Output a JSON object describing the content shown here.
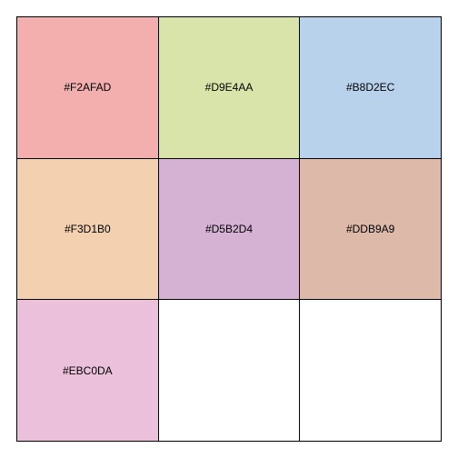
{
  "swatches": [
    {
      "label": "#F2AFAD",
      "color": "#F2AFAD"
    },
    {
      "label": "#D9E4AA",
      "color": "#D9E4AA"
    },
    {
      "label": "#B8D2EC",
      "color": "#B8D2EC"
    },
    {
      "label": "#F3D1B0",
      "color": "#F3D1B0"
    },
    {
      "label": "#D5B2D4",
      "color": "#D5B2D4"
    },
    {
      "label": "#DDB9A9",
      "color": "#DDB9A9"
    },
    {
      "label": "#EBC0DA",
      "color": "#EBC0DA"
    },
    {
      "label": "",
      "color": "#FFFFFF"
    },
    {
      "label": "",
      "color": "#FFFFFF"
    }
  ]
}
